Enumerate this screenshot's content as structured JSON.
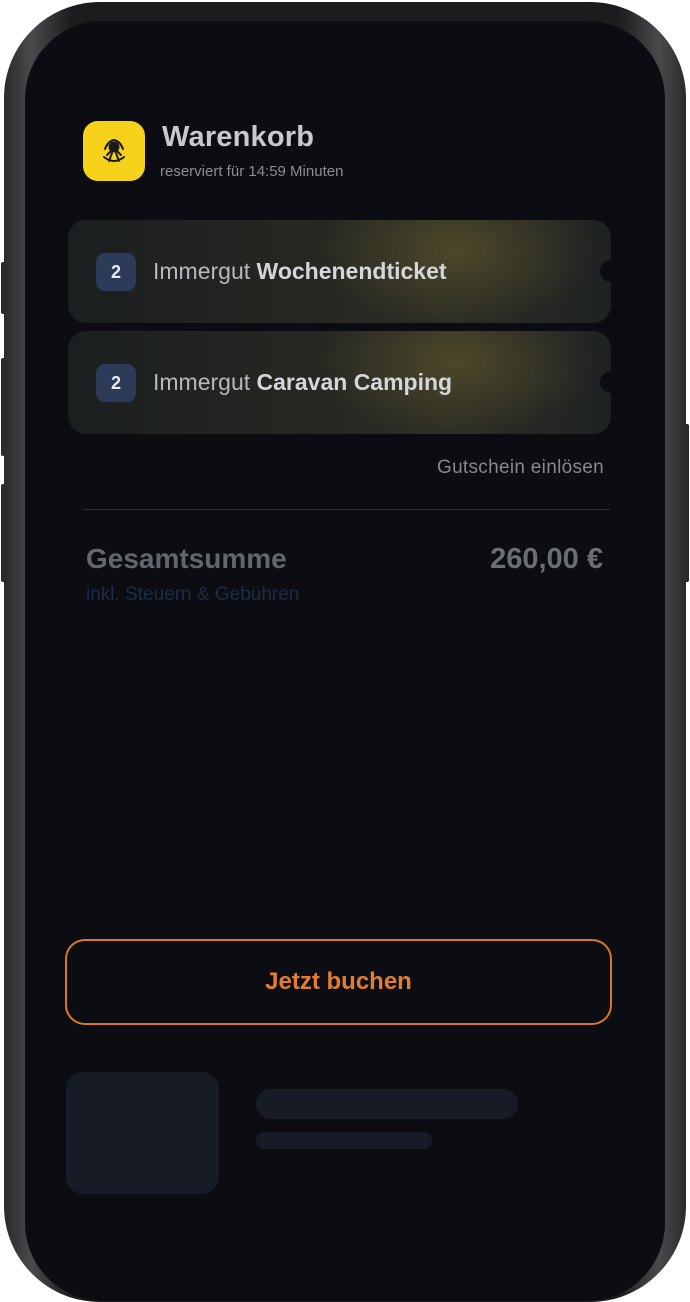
{
  "header": {
    "title": "Warenkorb",
    "subtitle": "reserviert für 14:59 Minuten",
    "logo_icon": "festival-logo-icon",
    "logo_color": "#f7d21a"
  },
  "cart": {
    "items": [
      {
        "quantity": "2",
        "prefix": "Immergut",
        "name": "Wochenendticket"
      },
      {
        "quantity": "2",
        "prefix": "Immergut",
        "name": "Caravan Camping"
      }
    ],
    "voucher_link": "Gutschein einlösen"
  },
  "summary": {
    "total_label": "Gesamtsumme",
    "total_note": "inkl. Steuern & Gebühren",
    "total_value": "260,00 €"
  },
  "actions": {
    "book_label": "Jetzt buchen",
    "accent_color": "#e27d2e"
  }
}
